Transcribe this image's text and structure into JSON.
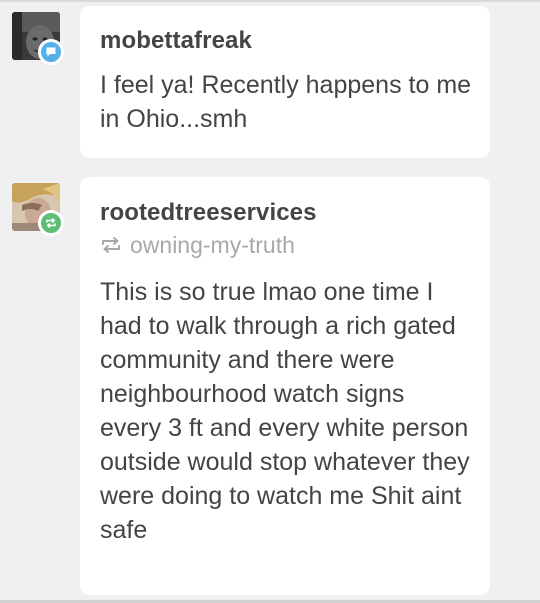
{
  "notes": [
    {
      "username": "mobettafreak",
      "badge_icon": "speech-bubble-icon",
      "badge_color": "#56b0e8",
      "text": "I feel ya! Recently happens to me in Ohio...smh"
    },
    {
      "username": "rootedtreeservices",
      "badge_icon": "reblog-icon",
      "badge_color": "#5cbf73",
      "reblog_source": "owning-my-truth",
      "text": "This is so true lmao one time I had to walk through a rich gated community and there were neighbourhood watch signs every 3 ft and every white person outside would stop whatever they were doing to watch me Shit aint safe"
    }
  ]
}
